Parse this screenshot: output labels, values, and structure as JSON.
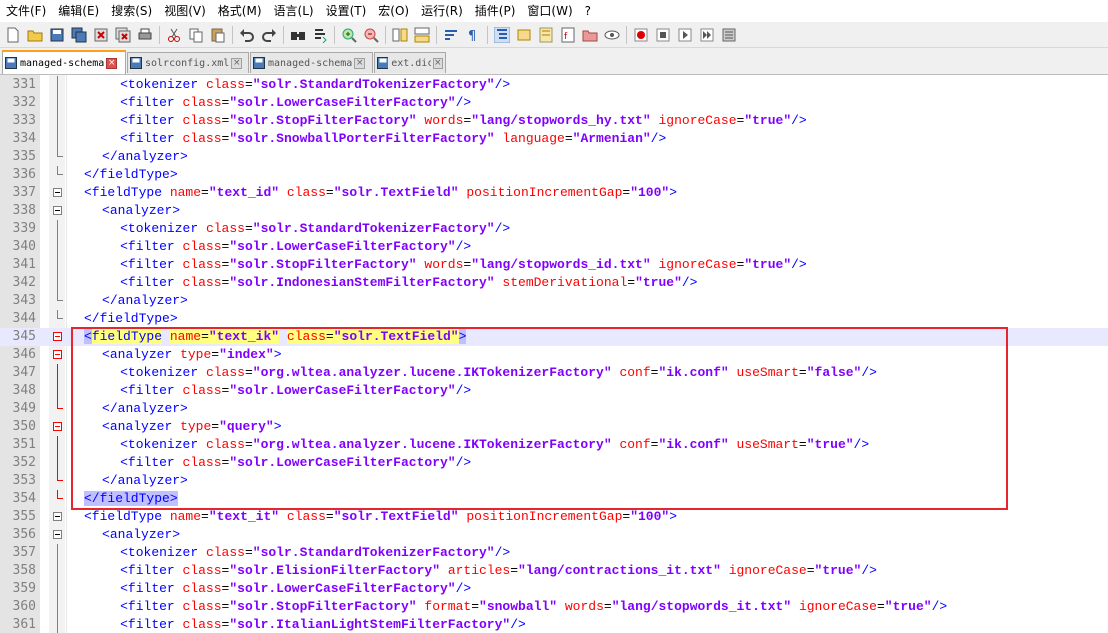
{
  "menu": [
    "文件(F)",
    "编辑(E)",
    "搜索(S)",
    "视图(V)",
    "格式(M)",
    "语言(L)",
    "设置(T)",
    "宏(O)",
    "运行(R)",
    "插件(P)",
    "窗口(W)",
    "?"
  ],
  "tabs": [
    {
      "label": "managed-schema",
      "active": true
    },
    {
      "label": "solrconfig.xml",
      "active": false
    },
    {
      "label": "managed-schema",
      "active": false
    },
    {
      "label": "ext.dic",
      "active": false
    }
  ],
  "colors": {
    "tag": "#0000ff",
    "attr": "#ff0000",
    "value": "#8000ff",
    "highlight_box": "#e8242c",
    "active_tab": "#ff9f1a"
  },
  "lines": [
    {
      "n": "331",
      "fold": "line",
      "indent": 2,
      "seg": [
        [
          "t",
          "<tokenizer "
        ],
        [
          "a",
          "class"
        ],
        [
          "p",
          "="
        ],
        [
          "v",
          "\"solr.StandardTokenizerFactory\""
        ],
        [
          "t",
          "/>"
        ]
      ]
    },
    {
      "n": "332",
      "fold": "line",
      "indent": 2,
      "seg": [
        [
          "t",
          "<filter "
        ],
        [
          "a",
          "class"
        ],
        [
          "p",
          "="
        ],
        [
          "v",
          "\"solr.LowerCaseFilterFactory\""
        ],
        [
          "t",
          "/>"
        ]
      ]
    },
    {
      "n": "333",
      "fold": "line",
      "indent": 2,
      "seg": [
        [
          "t",
          "<filter "
        ],
        [
          "a",
          "class"
        ],
        [
          "p",
          "="
        ],
        [
          "v",
          "\"solr.StopFilterFactory\""
        ],
        [
          "p",
          " "
        ],
        [
          "a",
          "words"
        ],
        [
          "p",
          "="
        ],
        [
          "v",
          "\"lang/stopwords_hy.txt\""
        ],
        [
          "p",
          " "
        ],
        [
          "a",
          "ignoreCase"
        ],
        [
          "p",
          "="
        ],
        [
          "v",
          "\"true\""
        ],
        [
          "t",
          "/>"
        ]
      ]
    },
    {
      "n": "334",
      "fold": "line",
      "indent": 2,
      "seg": [
        [
          "t",
          "<filter "
        ],
        [
          "a",
          "class"
        ],
        [
          "p",
          "="
        ],
        [
          "v",
          "\"solr.SnowballPorterFilterFactory\""
        ],
        [
          "p",
          " "
        ],
        [
          "a",
          "language"
        ],
        [
          "p",
          "="
        ],
        [
          "v",
          "\"Armenian\""
        ],
        [
          "t",
          "/>"
        ]
      ]
    },
    {
      "n": "335",
      "fold": "end",
      "indent": 1,
      "seg": [
        [
          "t",
          "</analyzer>"
        ]
      ]
    },
    {
      "n": "336",
      "fold": "end",
      "indent": 0,
      "seg": [
        [
          "t",
          "</fieldType>"
        ]
      ]
    },
    {
      "n": "337",
      "fold": "box",
      "indent": 0,
      "seg": [
        [
          "t",
          "<fieldType "
        ],
        [
          "a",
          "name"
        ],
        [
          "p",
          "="
        ],
        [
          "v",
          "\"text_id\""
        ],
        [
          "p",
          " "
        ],
        [
          "a",
          "class"
        ],
        [
          "p",
          "="
        ],
        [
          "v",
          "\"solr.TextField\""
        ],
        [
          "p",
          " "
        ],
        [
          "a",
          "positionIncrementGap"
        ],
        [
          "p",
          "="
        ],
        [
          "v",
          "\"100\""
        ],
        [
          "t",
          ">"
        ]
      ]
    },
    {
      "n": "338",
      "fold": "box",
      "indent": 1,
      "seg": [
        [
          "t",
          "<analyzer>"
        ]
      ]
    },
    {
      "n": "339",
      "fold": "line",
      "indent": 2,
      "seg": [
        [
          "t",
          "<tokenizer "
        ],
        [
          "a",
          "class"
        ],
        [
          "p",
          "="
        ],
        [
          "v",
          "\"solr.StandardTokenizerFactory\""
        ],
        [
          "t",
          "/>"
        ]
      ]
    },
    {
      "n": "340",
      "fold": "line",
      "indent": 2,
      "seg": [
        [
          "t",
          "<filter "
        ],
        [
          "a",
          "class"
        ],
        [
          "p",
          "="
        ],
        [
          "v",
          "\"solr.LowerCaseFilterFactory\""
        ],
        [
          "t",
          "/>"
        ]
      ]
    },
    {
      "n": "341",
      "fold": "line",
      "indent": 2,
      "seg": [
        [
          "t",
          "<filter "
        ],
        [
          "a",
          "class"
        ],
        [
          "p",
          "="
        ],
        [
          "v",
          "\"solr.StopFilterFactory\""
        ],
        [
          "p",
          " "
        ],
        [
          "a",
          "words"
        ],
        [
          "p",
          "="
        ],
        [
          "v",
          "\"lang/stopwords_id.txt\""
        ],
        [
          "p",
          " "
        ],
        [
          "a",
          "ignoreCase"
        ],
        [
          "p",
          "="
        ],
        [
          "v",
          "\"true\""
        ],
        [
          "t",
          "/>"
        ]
      ]
    },
    {
      "n": "342",
      "fold": "line",
      "indent": 2,
      "seg": [
        [
          "t",
          "<filter "
        ],
        [
          "a",
          "class"
        ],
        [
          "p",
          "="
        ],
        [
          "v",
          "\"solr.IndonesianStemFilterFactory\""
        ],
        [
          "p",
          " "
        ],
        [
          "a",
          "stemDerivational"
        ],
        [
          "p",
          "="
        ],
        [
          "v",
          "\"true\""
        ],
        [
          "t",
          "/>"
        ]
      ]
    },
    {
      "n": "343",
      "fold": "end",
      "indent": 1,
      "seg": [
        [
          "t",
          "</analyzer>"
        ]
      ]
    },
    {
      "n": "344",
      "fold": "end",
      "indent": 0,
      "seg": [
        [
          "t",
          "</fieldType>"
        ]
      ]
    },
    {
      "n": "345",
      "fold": "boxred",
      "indent": 0,
      "current": true,
      "seg": [
        [
          "t sel",
          "<"
        ],
        [
          "t hl",
          "fieldType"
        ],
        [
          "p",
          " "
        ],
        [
          "a hl",
          "name"
        ],
        [
          "p hl",
          "="
        ],
        [
          "v hl",
          "\"text_ik\""
        ],
        [
          "p",
          " "
        ],
        [
          "a hl",
          "class"
        ],
        [
          "p hl",
          "="
        ],
        [
          "v hl",
          "\"solr.TextField\""
        ],
        [
          "t sel",
          ">"
        ]
      ]
    },
    {
      "n": "346",
      "fold": "boxred",
      "indent": 1,
      "seg": [
        [
          "t",
          "<analyzer "
        ],
        [
          "a",
          "type"
        ],
        [
          "p",
          "="
        ],
        [
          "v",
          "\"index\""
        ],
        [
          "t",
          ">"
        ]
      ]
    },
    {
      "n": "347",
      "fold": "linered",
      "indent": 2,
      "seg": [
        [
          "t",
          "<tokenizer "
        ],
        [
          "a",
          "class"
        ],
        [
          "p",
          "="
        ],
        [
          "v",
          "\"org.wltea.analyzer.lucene.IKTokenizerFactory\""
        ],
        [
          "p",
          " "
        ],
        [
          "a",
          "conf"
        ],
        [
          "p",
          "="
        ],
        [
          "v",
          "\"ik.conf\""
        ],
        [
          "p",
          " "
        ],
        [
          "a",
          "useSmart"
        ],
        [
          "p",
          "="
        ],
        [
          "v",
          "\"false\""
        ],
        [
          "t",
          "/>"
        ]
      ]
    },
    {
      "n": "348",
      "fold": "linered",
      "indent": 2,
      "seg": [
        [
          "t",
          "<filter "
        ],
        [
          "a",
          "class"
        ],
        [
          "p",
          "="
        ],
        [
          "v",
          "\"solr.LowerCaseFilterFactory\""
        ],
        [
          "t",
          "/>"
        ]
      ]
    },
    {
      "n": "349",
      "fold": "endred",
      "indent": 1,
      "seg": [
        [
          "t",
          "</analyzer>"
        ]
      ]
    },
    {
      "n": "350",
      "fold": "boxred",
      "indent": 1,
      "seg": [
        [
          "t",
          "<analyzer "
        ],
        [
          "a",
          "type"
        ],
        [
          "p",
          "="
        ],
        [
          "v",
          "\"query\""
        ],
        [
          "t",
          ">"
        ]
      ]
    },
    {
      "n": "351",
      "fold": "linered",
      "indent": 2,
      "seg": [
        [
          "t",
          "<tokenizer "
        ],
        [
          "a",
          "class"
        ],
        [
          "p",
          "="
        ],
        [
          "v",
          "\"org.wltea.analyzer.lucene.IKTokenizerFactory\""
        ],
        [
          "p",
          " "
        ],
        [
          "a",
          "conf"
        ],
        [
          "p",
          "="
        ],
        [
          "v",
          "\"ik.conf\""
        ],
        [
          "p",
          " "
        ],
        [
          "a",
          "useSmart"
        ],
        [
          "p",
          "="
        ],
        [
          "v",
          "\"true\""
        ],
        [
          "t",
          "/>"
        ]
      ]
    },
    {
      "n": "352",
      "fold": "linered",
      "indent": 2,
      "seg": [
        [
          "t",
          "<filter "
        ],
        [
          "a",
          "class"
        ],
        [
          "p",
          "="
        ],
        [
          "v",
          "\"solr.LowerCaseFilterFactory\""
        ],
        [
          "t",
          "/>"
        ]
      ]
    },
    {
      "n": "353",
      "fold": "endred",
      "indent": 1,
      "seg": [
        [
          "t",
          "</analyzer>"
        ]
      ]
    },
    {
      "n": "354",
      "fold": "endred",
      "indent": 0,
      "seg": [
        [
          "t sel",
          "</fieldType>"
        ]
      ]
    },
    {
      "n": "355",
      "fold": "box",
      "indent": 0,
      "seg": [
        [
          "t",
          "<fieldType "
        ],
        [
          "a",
          "name"
        ],
        [
          "p",
          "="
        ],
        [
          "v",
          "\"text_it\""
        ],
        [
          "p",
          " "
        ],
        [
          "a",
          "class"
        ],
        [
          "p",
          "="
        ],
        [
          "v",
          "\"solr.TextField\""
        ],
        [
          "p",
          " "
        ],
        [
          "a",
          "positionIncrementGap"
        ],
        [
          "p",
          "="
        ],
        [
          "v",
          "\"100\""
        ],
        [
          "t",
          ">"
        ]
      ]
    },
    {
      "n": "356",
      "fold": "box",
      "indent": 1,
      "seg": [
        [
          "t",
          "<analyzer>"
        ]
      ]
    },
    {
      "n": "357",
      "fold": "line",
      "indent": 2,
      "seg": [
        [
          "t",
          "<tokenizer "
        ],
        [
          "a",
          "class"
        ],
        [
          "p",
          "="
        ],
        [
          "v",
          "\"solr.StandardTokenizerFactory\""
        ],
        [
          "t",
          "/>"
        ]
      ]
    },
    {
      "n": "358",
      "fold": "line",
      "indent": 2,
      "seg": [
        [
          "t",
          "<filter "
        ],
        [
          "a",
          "class"
        ],
        [
          "p",
          "="
        ],
        [
          "v",
          "\"solr.ElisionFilterFactory\""
        ],
        [
          "p",
          " "
        ],
        [
          "a",
          "articles"
        ],
        [
          "p",
          "="
        ],
        [
          "v",
          "\"lang/contractions_it.txt\""
        ],
        [
          "p",
          " "
        ],
        [
          "a",
          "ignoreCase"
        ],
        [
          "p",
          "="
        ],
        [
          "v",
          "\"true\""
        ],
        [
          "t",
          "/>"
        ]
      ]
    },
    {
      "n": "359",
      "fold": "line",
      "indent": 2,
      "seg": [
        [
          "t",
          "<filter "
        ],
        [
          "a",
          "class"
        ],
        [
          "p",
          "="
        ],
        [
          "v",
          "\"solr.LowerCaseFilterFactory\""
        ],
        [
          "t",
          "/>"
        ]
      ]
    },
    {
      "n": "360",
      "fold": "line",
      "indent": 2,
      "seg": [
        [
          "t",
          "<filter "
        ],
        [
          "a",
          "class"
        ],
        [
          "p",
          "="
        ],
        [
          "v",
          "\"solr.StopFilterFactory\""
        ],
        [
          "p",
          " "
        ],
        [
          "a",
          "format"
        ],
        [
          "p",
          "="
        ],
        [
          "v",
          "\"snowball\""
        ],
        [
          "p",
          " "
        ],
        [
          "a",
          "words"
        ],
        [
          "p",
          "="
        ],
        [
          "v",
          "\"lang/stopwords_it.txt\""
        ],
        [
          "p",
          " "
        ],
        [
          "a",
          "ignoreCase"
        ],
        [
          "p",
          "="
        ],
        [
          "v",
          "\"true\""
        ],
        [
          "t",
          "/>"
        ]
      ]
    },
    {
      "n": "361",
      "fold": "line",
      "indent": 2,
      "seg": [
        [
          "t",
          "<filter "
        ],
        [
          "a",
          "class"
        ],
        [
          "p",
          "="
        ],
        [
          "v",
          "\"solr.ItalianLightStemFilterFactory\""
        ],
        [
          "t",
          "/>"
        ]
      ]
    }
  ]
}
